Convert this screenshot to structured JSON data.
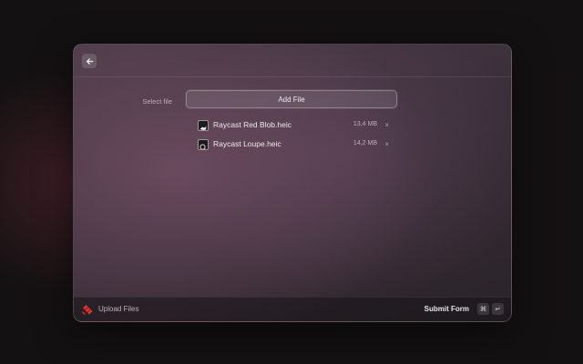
{
  "window": {
    "back_icon": "arrow-left-icon"
  },
  "form": {
    "select_file_label": "Select file",
    "add_file_label": "Add File",
    "files": [
      {
        "name": "Raycast Red Blob.heic",
        "size": "13,4 MB",
        "remove": "×",
        "thumb_icon": "blob-thumbnail-icon"
      },
      {
        "name": "Raycast Loupe.heic",
        "size": "14,2 MB",
        "remove": "×",
        "thumb_icon": "loupe-thumbnail-icon"
      }
    ]
  },
  "footer": {
    "title": "Upload Files",
    "logo_icon": "raycast-logo-icon",
    "logo_color": "#e8322c",
    "submit_label": "Submit Form",
    "shortcut_cmd": "⌘",
    "shortcut_enter": "↵"
  }
}
